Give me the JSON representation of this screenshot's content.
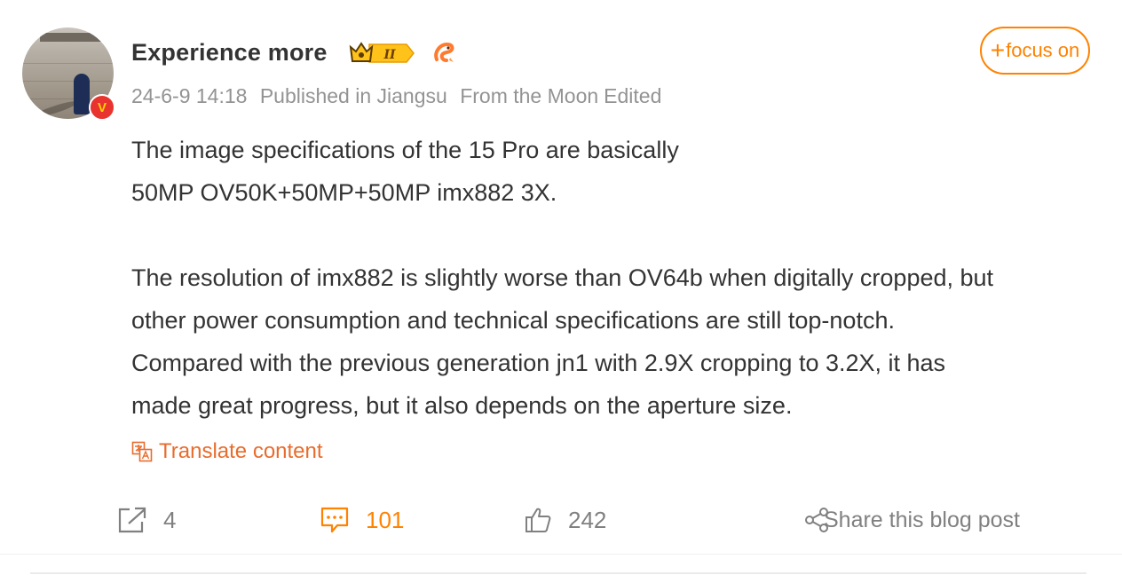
{
  "post": {
    "author": {
      "name": "Experience more",
      "verified_badge": "V",
      "crown_label": "II"
    },
    "meta": {
      "time": "24-6-9 14:18",
      "location": "Published in Jiangsu",
      "source": "From the Moon",
      "edited": "Edited"
    },
    "follow_button": {
      "plus": "+",
      "label": "focus on"
    },
    "content": {
      "lines": [
        "The image specifications of the 15 Pro are basically",
        "50MP OV50K+50MP+50MP imx882 3X.",
        "",
        "The resolution of imx882 is slightly worse than OV64b when digitally cropped, but",
        "other power consumption and technical specifications are still top-notch.",
        "Compared with the previous generation jn1 with 2.9X cropping to 3.2X, it has",
        "made great progress, but it also depends on the aperture size."
      ]
    },
    "translate_label": "Translate content",
    "actions": {
      "repost_count": "4",
      "comment_count": "101",
      "like_count": "242",
      "share_label": "Share this blog post"
    },
    "colors": {
      "accent": "#ff8200",
      "translate": "#e86c2d",
      "meta_text": "#939393",
      "verified": "#e8332e"
    },
    "icons": [
      "crown-badge-icon",
      "shrimp-icon",
      "translate-icon",
      "repost-icon",
      "comment-icon",
      "like-icon",
      "share-icon"
    ]
  }
}
